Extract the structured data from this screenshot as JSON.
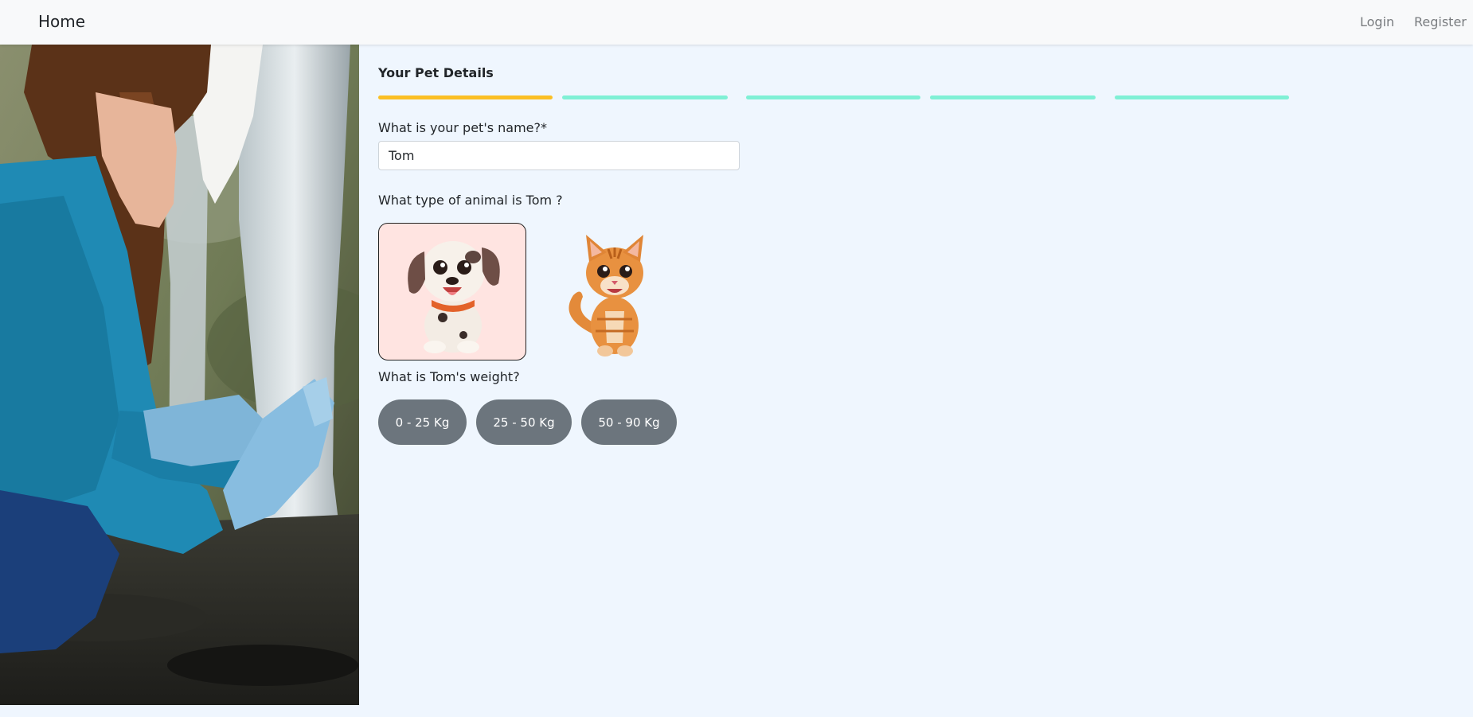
{
  "nav": {
    "brand": "Home",
    "login": "Login",
    "register": "Register"
  },
  "form": {
    "title": "Your Pet Details",
    "progress": {
      "current_step": 1,
      "total_steps": 5,
      "active_color": "#fbbf24",
      "inactive_color": "#7ff0d5"
    },
    "name_question": "What is your pet's name?*",
    "name_value": "Tom",
    "animal_question": "What type of animal is Tom ?",
    "animal_options": [
      {
        "id": "dog",
        "icon": "dog-icon",
        "selected": true
      },
      {
        "id": "cat",
        "icon": "cat-icon",
        "selected": false
      }
    ],
    "weight_question": "What is Tom's weight?",
    "weight_options": [
      "0 - 25 Kg",
      "25 - 50 Kg",
      "50 - 90 Kg"
    ]
  },
  "colors": {
    "page_background": "#eff6fe",
    "selected_card": "#ffe4e1",
    "weight_button": "#6c757d"
  }
}
